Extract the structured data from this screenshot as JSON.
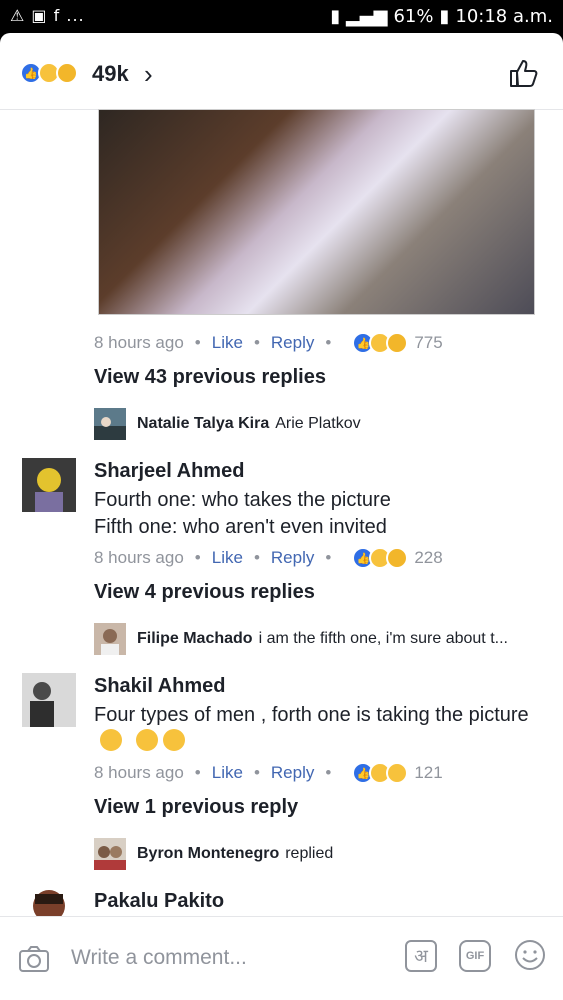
{
  "status_bar": {
    "left_icons": "⚠ ▣ f ...",
    "battery": "61%",
    "time": "10:18 a.m."
  },
  "header": {
    "reaction_count": "49k"
  },
  "first_comment": {
    "time": "8 hours ago",
    "like_label": "Like",
    "reply_label": "Reply",
    "reaction_count": "775",
    "view_replies": "View 43 previous replies",
    "latest_reply": {
      "author": "Natalie Talya Kira",
      "text": "Arie Platkov"
    }
  },
  "comments": [
    {
      "author": "Sharjeel Ahmed",
      "line1": "Fourth one: who takes the picture",
      "line2": "Fifth one: who aren't even invited",
      "time": "8 hours ago",
      "like_label": "Like",
      "reply_label": "Reply",
      "reaction_count": "228",
      "view_replies": "View 4 previous replies",
      "latest_reply": {
        "author": "Filipe Machado",
        "text": "i am the fifth one, i'm sure about t..."
      }
    },
    {
      "author": "Shakil Ahmed",
      "text": "Four types of men , forth one is taking the picture",
      "time": "8 hours ago",
      "like_label": "Like",
      "reply_label": "Reply",
      "reaction_count": "121",
      "view_replies": "View 1 previous reply",
      "latest_reply": {
        "author": "Byron Montenegro",
        "text": "replied"
      }
    },
    {
      "author": "Pakalu Pakito"
    }
  ],
  "composer": {
    "placeholder": "Write a comment...",
    "hindi_button": "अ",
    "gif_button": "GIF"
  },
  "colors": {
    "link": "#4267b2",
    "meta": "#90949c",
    "text": "#1d2129",
    "like_blue": "#2f6ee5",
    "emoji_yellow": "#f7c23c"
  }
}
